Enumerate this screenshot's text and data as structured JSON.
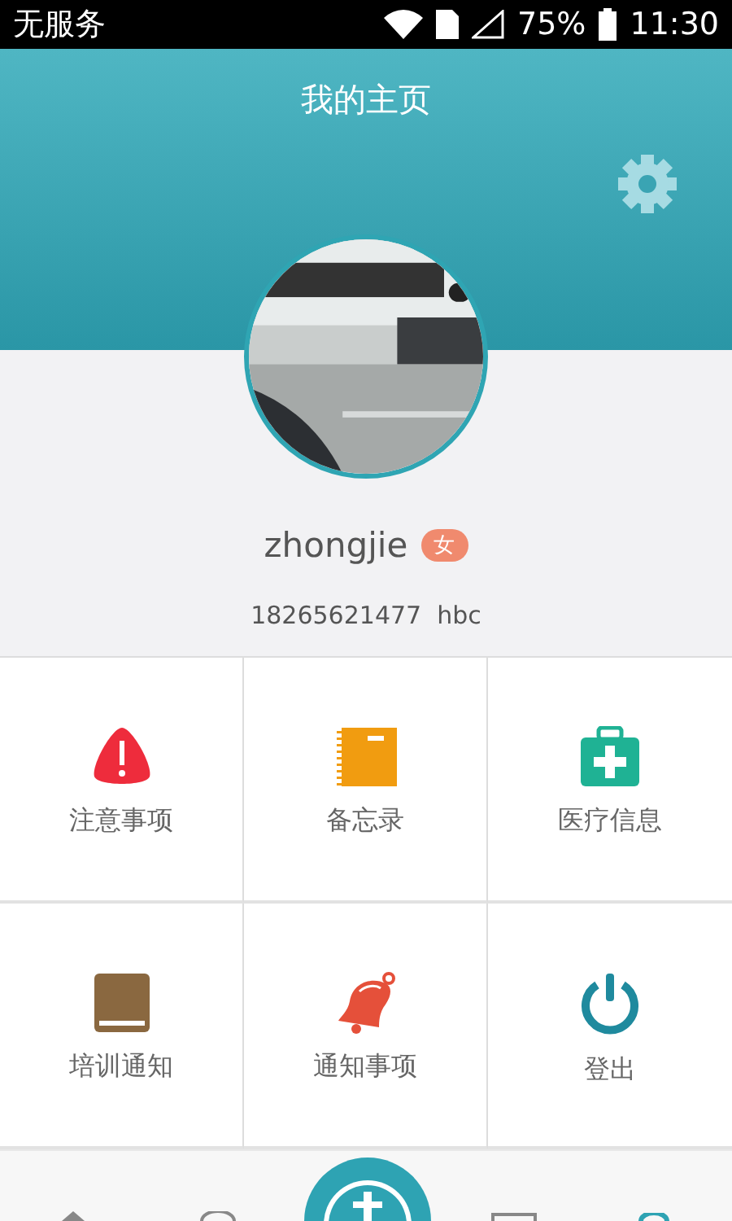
{
  "status_bar": {
    "carrier": "无服务",
    "battery": "75%",
    "time": "11:30"
  },
  "header": {
    "title": "我的主页"
  },
  "profile": {
    "name": "zhongjie",
    "gender": "女",
    "phone": "18265621477",
    "username": "hbc"
  },
  "menu": [
    {
      "label": "注意事项",
      "kind": "warning"
    },
    {
      "label": "备忘录",
      "kind": "notebook"
    },
    {
      "label": "医疗信息",
      "kind": "medkit"
    },
    {
      "label": "培训通知",
      "kind": "book"
    },
    {
      "label": "通知事项",
      "kind": "bell"
    },
    {
      "label": "登出",
      "kind": "power"
    }
  ]
}
